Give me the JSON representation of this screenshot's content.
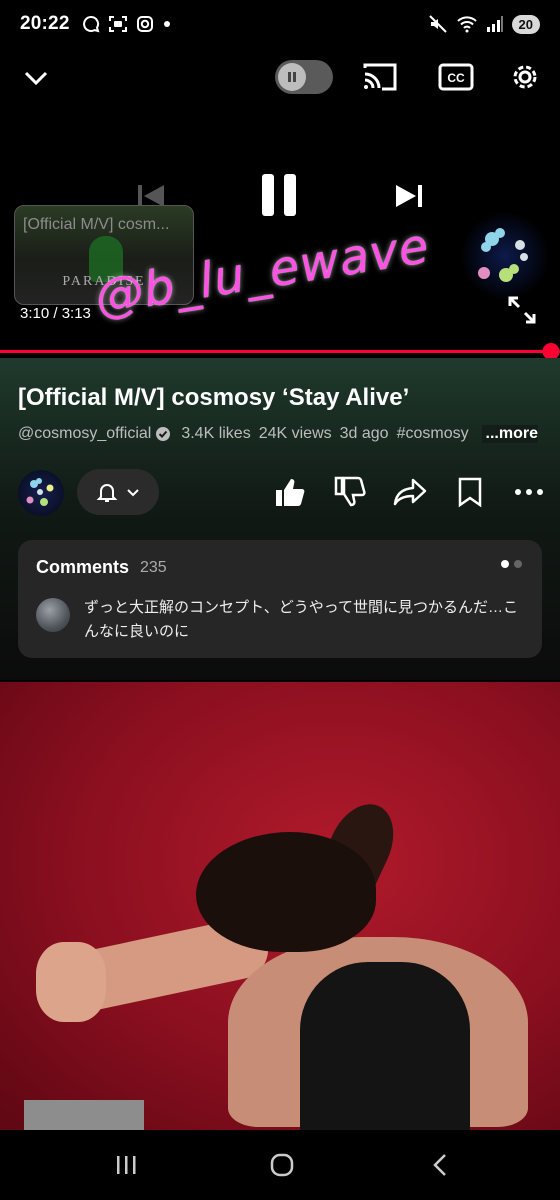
{
  "status_bar": {
    "time": "20:22",
    "battery": "20",
    "left_icons": [
      "chat-bubble-icon",
      "screen-capture-icon",
      "instagram-icon",
      "dot-icon"
    ],
    "right_icons": [
      "mute-icon",
      "wifi-icon",
      "signal-icon"
    ]
  },
  "player": {
    "preview_title": "[Official M/V] cosm...",
    "preview_logo": "PARADISE",
    "time_display": "3:10 / 3:13",
    "progress": 0.984,
    "watermark": "@b_lu_ewave",
    "icons": [
      "chevron-down-icon",
      "autoplay-toggle",
      "cast-icon",
      "captions-icon",
      "settings-icon",
      "previous-icon",
      "pause-icon",
      "next-icon",
      "fullscreen-icon"
    ]
  },
  "video": {
    "title": "[Official M/V] cosmosy ‘Stay Alive’",
    "channel": "@cosmosy_official",
    "likes": "3.4K likes",
    "views": "24K views",
    "age": "3d ago",
    "tag": "#cosmosy",
    "more": "...more"
  },
  "actions": [
    "subscribe-bell",
    "like",
    "dislike",
    "share",
    "save",
    "more"
  ],
  "comments": {
    "label": "Comments",
    "count": "235",
    "text": "ずっと大正解のコンセプト、どうやって世間に見つかるんだ…こんなに良いのに"
  },
  "colors": {
    "accent": "#ff0033",
    "watermark": "#ff52e5",
    "card": "#262626"
  }
}
